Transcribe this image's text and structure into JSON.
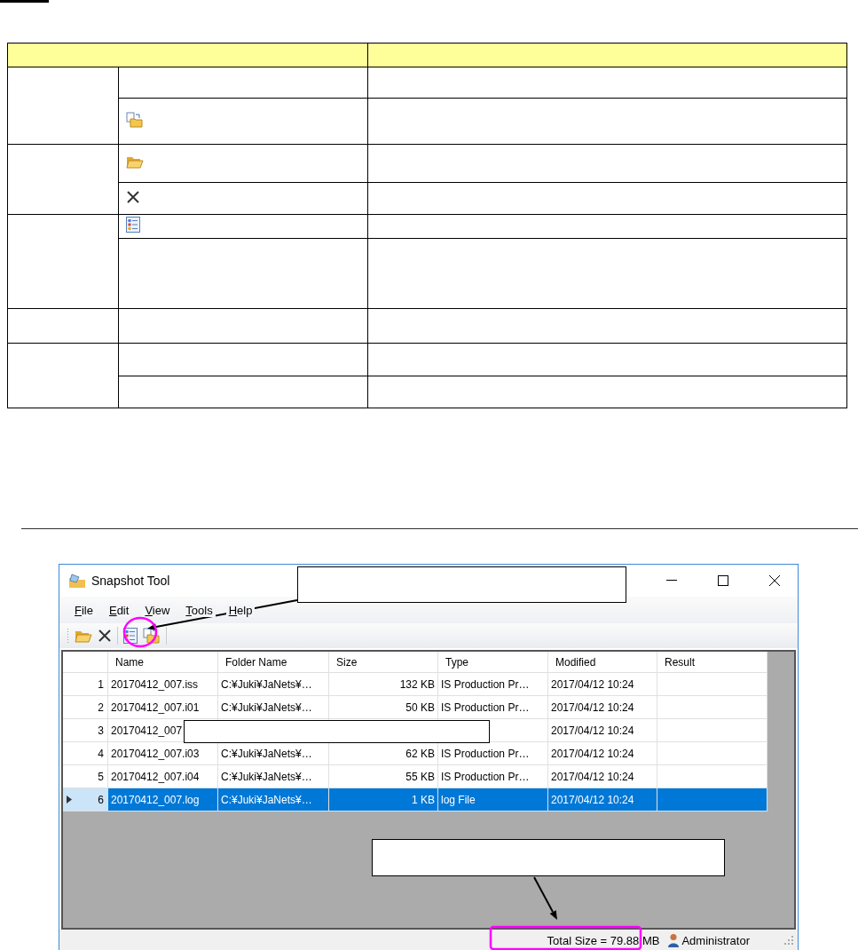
{
  "window": {
    "title": "Snapshot Tool",
    "menu": [
      "File",
      "Edit",
      "View",
      "Tools",
      "Help"
    ],
    "grid": {
      "columns": [
        "Name",
        "Folder Name",
        "Size",
        "Type",
        "Modified",
        "Result"
      ],
      "rows": [
        {
          "number": "1",
          "cells": [
            "20170412_007.iss",
            "C:¥Juki¥JaNets¥…",
            "132 KB",
            "IS Production Pr…",
            "2017/04/12 10:24"
          ],
          "selected": false
        },
        {
          "number": "2",
          "cells": [
            "20170412_007.i01",
            "C:¥Juki¥JaNets¥…",
            "50 KB",
            "IS Production Pr…",
            "2017/04/12 10:24"
          ],
          "selected": false
        },
        {
          "number": "3",
          "cells": [
            "20170412_007",
            "",
            "",
            "",
            "2017/04/12 10:24"
          ],
          "selected": false
        },
        {
          "number": "4",
          "cells": [
            "20170412_007.i03",
            "C:¥Juki¥JaNets¥…",
            "62 KB",
            "IS Production Pr…",
            "2017/04/12 10:24"
          ],
          "selected": false
        },
        {
          "number": "5",
          "cells": [
            "20170412_007.i04",
            "C:¥Juki¥JaNets¥…",
            "55 KB",
            "IS Production Pr…",
            "2017/04/12 10:24"
          ],
          "selected": false
        },
        {
          "number": "6",
          "cells": [
            "20170412_007.log",
            "C:¥Juki¥JaNets¥…",
            "1 KB",
            "log File",
            "2017/04/12 10:24"
          ],
          "selected": true
        }
      ]
    },
    "status_bar": {
      "total_size": "Total Size =  79.88 MB",
      "user": "Administrator"
    }
  }
}
